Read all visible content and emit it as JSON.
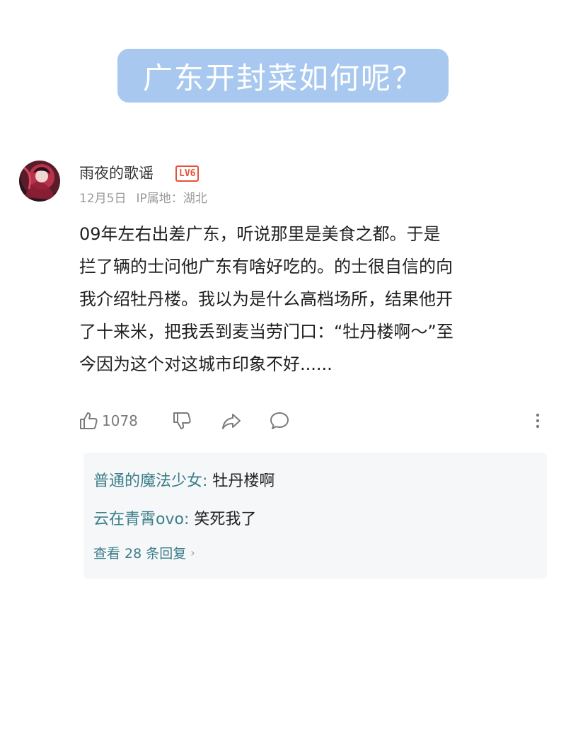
{
  "banner": {
    "title": "广东开封菜如何呢？"
  },
  "comment": {
    "author": "雨夜的歌谣",
    "level_badge": "LV6",
    "date": "12月5日",
    "location": "IP属地：湖北",
    "body_lines": [
      "09年左右出差广东，听说那里是美食之都。于是",
      "拦了辆的士问他广东有啥好吃的。的士很自信的向",
      "我介绍牡丹楼。我以为是什么高档场所，结果他开",
      "了十来米，把我丢到麦当劳门口：“牡丹楼啊～”至",
      "今因为这个对这城市印象不好......"
    ],
    "actions": {
      "like_icon": "thumb-up-icon",
      "like_count": "1078",
      "dislike_icon": "thumb-down-icon",
      "share_icon": "share-icon",
      "comment_icon": "comment-icon",
      "more_icon": "more-vertical-icon"
    }
  },
  "replies": {
    "items": [
      {
        "name": "普通的魔法少女",
        "separator": ": ",
        "text": "牡丹楼啊"
      },
      {
        "name": "云在青霄ovo",
        "separator": ": ",
        "text": "笑死我了"
      }
    ],
    "view_more": "查看 28 条回复",
    "view_more_icon": "chevron-right-icon"
  },
  "colors": {
    "banner_bg": "#a9c8ef",
    "reply_name": "#3a7e89",
    "badge": "#e8513d",
    "meta": "#9a9a9a"
  }
}
